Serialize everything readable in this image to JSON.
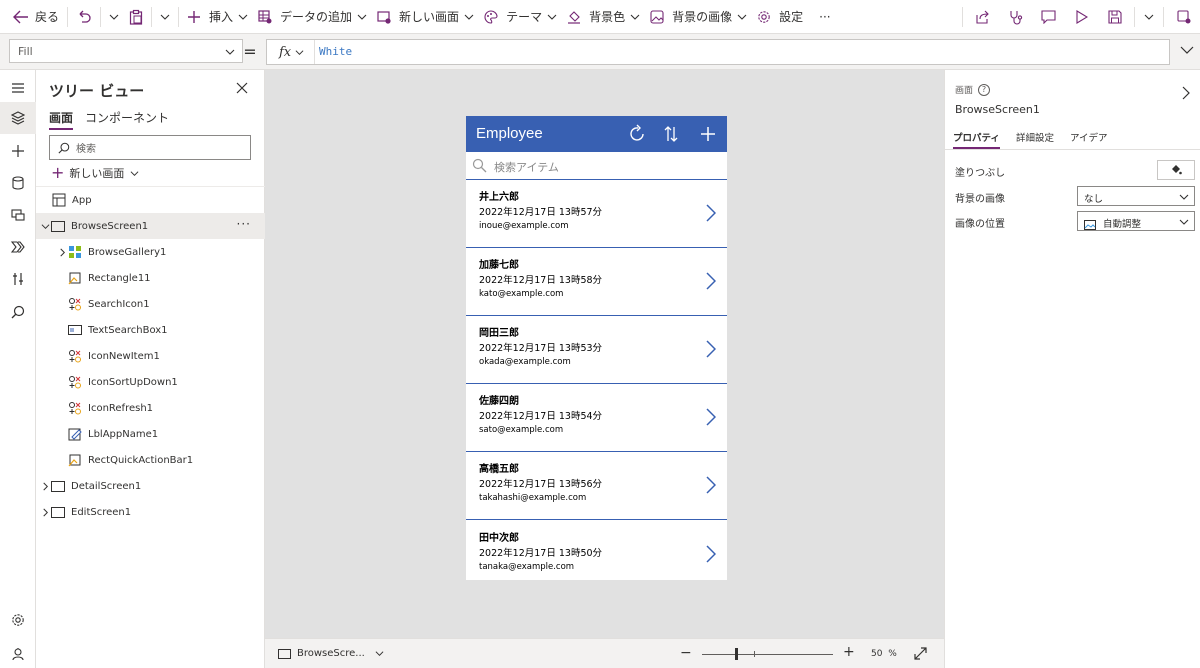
{
  "toolbar": {
    "back_label": "戻る",
    "insert_label": "挿入",
    "add_data_label": "データの追加",
    "new_screen_label": "新しい画面",
    "theme_label": "テーマ",
    "background_color_label": "背景色",
    "background_image_label": "背景の画像",
    "settings_label": "設定",
    "more_label": "···"
  },
  "formula_bar": {
    "property": "Fill",
    "equals": "=",
    "fx_label": "fx",
    "formula": "White"
  },
  "tree_view": {
    "title": "ツリー ビュー",
    "tabs": [
      {
        "label": "画面",
        "active": true
      },
      {
        "label": "コンポーネント",
        "active": false
      }
    ],
    "search_placeholder": "検索",
    "new_screen_label": "新しい画面",
    "items": [
      {
        "label": "App",
        "icon": "app-icon"
      },
      {
        "label": "BrowseScreen1",
        "icon": "screen-icon",
        "selected": true,
        "more": "···"
      },
      {
        "label": "BrowseGallery1",
        "icon": "gallery-icon"
      },
      {
        "label": "Rectangle11",
        "icon": "rectangle-icon"
      },
      {
        "label": "SearchIcon1",
        "icon": "icon-control-icon"
      },
      {
        "label": "TextSearchBox1",
        "icon": "text-input-icon"
      },
      {
        "label": "IconNewItem1",
        "icon": "icon-control-icon"
      },
      {
        "label": "IconSortUpDown1",
        "icon": "icon-control-icon"
      },
      {
        "label": "IconRefresh1",
        "icon": "icon-control-icon"
      },
      {
        "label": "LblAppName1",
        "icon": "label-icon"
      },
      {
        "label": "RectQuickActionBar1",
        "icon": "rectangle-icon"
      },
      {
        "label": "DetailScreen1",
        "icon": "screen-icon"
      },
      {
        "label": "EditScreen1",
        "icon": "screen-icon"
      }
    ]
  },
  "app_preview": {
    "title": "Employee",
    "header_color": "#3860b2",
    "search_placeholder": "検索アイテム",
    "items": [
      {
        "name": "井上六郎",
        "date": "2022年12月17日 13時57分",
        "email": "inoue@example.com"
      },
      {
        "name": "加藤七郎",
        "date": "2022年12月17日 13時58分",
        "email": "kato@example.com"
      },
      {
        "name": "岡田三郎",
        "date": "2022年12月17日 13時53分",
        "email": "okada@example.com"
      },
      {
        "name": "佐藤四朗",
        "date": "2022年12月17日 13時54分",
        "email": "sato@example.com"
      },
      {
        "name": "高橋五郎",
        "date": "2022年12月17日 13時56分",
        "email": "takahashi@example.com"
      },
      {
        "name": "田中次郎",
        "date": "2022年12月17日 13時50分",
        "email": "tanaka@example.com"
      }
    ]
  },
  "status_bar": {
    "screen_name": "BrowseScre...",
    "zoom_value": "50",
    "zoom_unit": "%",
    "zoom_minus": "−",
    "zoom_plus": "+"
  },
  "properties_panel": {
    "kind_label": "画面",
    "help_glyph": "?",
    "screen_name": "BrowseScreen1",
    "tabs": [
      {
        "label": "プロパティ",
        "active": true
      },
      {
        "label": "詳細設定",
        "active": false
      },
      {
        "label": "アイデア",
        "active": false
      }
    ],
    "fill_label": "塗りつぶし",
    "background_image_label": "背景の画像",
    "background_image_value": "なし",
    "image_position_label": "画像の位置",
    "image_position_value": "自動調整"
  },
  "colors": {
    "accent": "#742774",
    "app_header": "#3860b2",
    "canvas_bg": "#e1e1e1",
    "formula_text": "#3b78c3"
  }
}
